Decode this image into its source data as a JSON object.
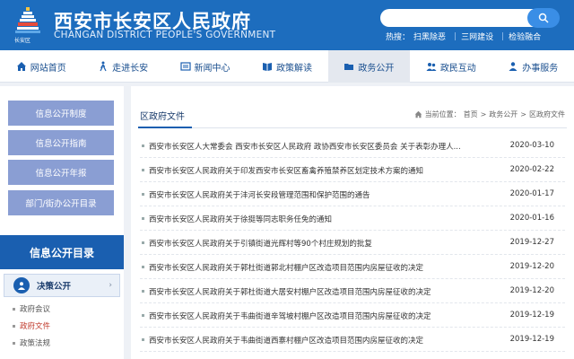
{
  "header": {
    "title": "西安市长安区人民政府",
    "subtitle": "CHANGAN DISTRICT PEOPLE'S GOVERNMENT",
    "logo_caption": "长安区",
    "hot_label": "热搜：",
    "hot_links": [
      "扫黑除恶",
      "三网建设",
      "检验融合"
    ]
  },
  "nav": [
    {
      "label": "网站首页",
      "icon": "home-icon"
    },
    {
      "label": "走进长安",
      "icon": "walk-icon"
    },
    {
      "label": "新闻中心",
      "icon": "news-icon"
    },
    {
      "label": "政策解读",
      "icon": "book-icon"
    },
    {
      "label": "政务公开",
      "icon": "folder-icon",
      "active": true
    },
    {
      "label": "政民互动",
      "icon": "people-icon"
    },
    {
      "label": "办事服务",
      "icon": "service-icon"
    }
  ],
  "sidebar": {
    "buttons": [
      "信息公开制度",
      "信息公开指南",
      "信息公开年报",
      "部门/街办公开目录"
    ],
    "directory_title": "信息公开目录",
    "section": "决策公开",
    "items": [
      {
        "label": "政府会议"
      },
      {
        "label": "政府文件",
        "active": true
      },
      {
        "label": "政策法规"
      }
    ]
  },
  "main": {
    "title": "区政府文件",
    "breadcrumb": {
      "prefix": "当前位置：",
      "items": [
        "首页",
        "政务公开",
        "区政府文件"
      ],
      "sep": ">"
    },
    "rows": [
      {
        "title": "西安市长安区人大常委会 西安市长安区人民政府 政协西安市长安区委员会 关于表彰办理人...",
        "date": "2020-03-10"
      },
      {
        "title": "西安市长安区人民政府关于印发西安市长安区畜禽养殖禁养区划定技术方案的通知",
        "date": "2020-02-22"
      },
      {
        "title": "西安市长安区人民政府关于沣河长安段管理范围和保护范围的通告",
        "date": "2020-01-17"
      },
      {
        "title": "西安市长安区人民政府关于徐挺等同志职务任免的通知",
        "date": "2020-01-16"
      },
      {
        "title": "西安市长安区人民政府关于引镇街道光辉村等90个村庄规划的批复",
        "date": "2019-12-27"
      },
      {
        "title": "西安市长安区人民政府关于郭杜街道郭北村棚户区改造项目范围内房屋征收的决定",
        "date": "2019-12-20"
      },
      {
        "title": "西安市长安区人民政府关于郭杜街道大居安村棚户区改造项目范围内房屋征收的决定",
        "date": "2019-12-20"
      },
      {
        "title": "西安市长安区人民政府关于韦曲街道辛驾坡村棚户区改造项目范围内房屋征收的决定",
        "date": "2019-12-19"
      },
      {
        "title": "西安市长安区人民政府关于韦曲街道西寨村棚户区改造项目范围内房屋征收的决定",
        "date": "2019-12-19"
      }
    ]
  }
}
